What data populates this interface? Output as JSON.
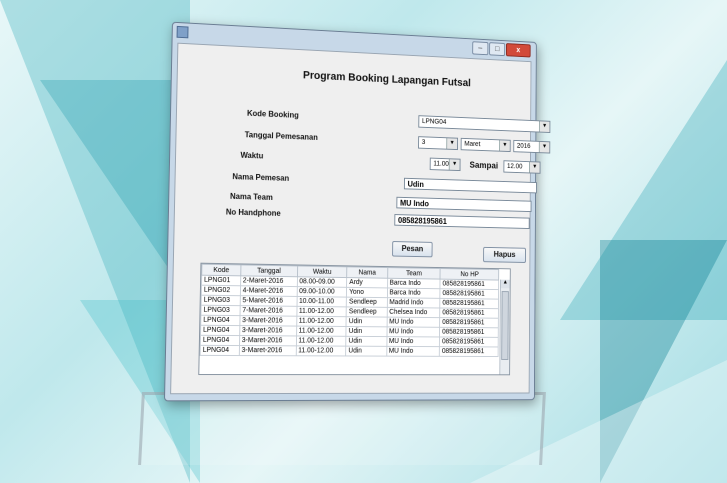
{
  "window": {
    "close_glyph": "x",
    "minimize_glyph": "–",
    "maximize_glyph": "□"
  },
  "app": {
    "title": "Program Booking Lapangan Futsal"
  },
  "form": {
    "kode_booking_label": "Kode Booking",
    "kode_booking_value": "LPNG04",
    "tanggal_label": "Tanggal Pemesanan",
    "tanggal_day": "3",
    "tanggal_month": "Maret",
    "tanggal_year": "2016",
    "waktu_label": "Waktu",
    "waktu_start": "11.00",
    "sampai_label": "Sampai",
    "waktu_end": "12.00",
    "nama_pemesan_label": "Nama Pemesan",
    "nama_pemesan_value": "Udin",
    "nama_team_label": "Nama Team",
    "nama_team_value": "MU Indo",
    "no_hp_label": "No Handphone",
    "no_hp_value": "085828195861"
  },
  "buttons": {
    "pesan": "Pesan",
    "hapus": "Hapus"
  },
  "table": {
    "columns": [
      "Kode",
      "Tanggal",
      "Waktu",
      "Nama",
      "Team",
      "No HP"
    ],
    "rows": [
      [
        "LPNG01",
        "2-Maret-2016",
        "08.00-09.00",
        "Ardy",
        "Barca Indo",
        "085828195861"
      ],
      [
        "LPNG02",
        "4-Maret-2016",
        "09.00-10.00",
        "Yono",
        "Barca Indo",
        "085828195861"
      ],
      [
        "LPNG03",
        "5-Maret-2016",
        "10.00-11.00",
        "Sendleep",
        "Madrid Indo",
        "085828195861"
      ],
      [
        "LPNG03",
        "7-Maret-2016",
        "11.00-12.00",
        "Sendleep",
        "Chelsea Indo",
        "085828195861"
      ],
      [
        "LPNG04",
        "3-Maret-2016",
        "11.00-12.00",
        "Udin",
        "MU Indo",
        "085828195861"
      ],
      [
        "LPNG04",
        "3-Maret-2016",
        "11.00-12.00",
        "Udin",
        "MU Indo",
        "085828195861"
      ],
      [
        "LPNG04",
        "3-Maret-2016",
        "11.00-12.00",
        "Udin",
        "MU Indo",
        "085828195861"
      ],
      [
        "LPNG04",
        "3-Maret-2016",
        "11.00-12.00",
        "Udin",
        "MU Indo",
        "085828195861"
      ]
    ]
  }
}
